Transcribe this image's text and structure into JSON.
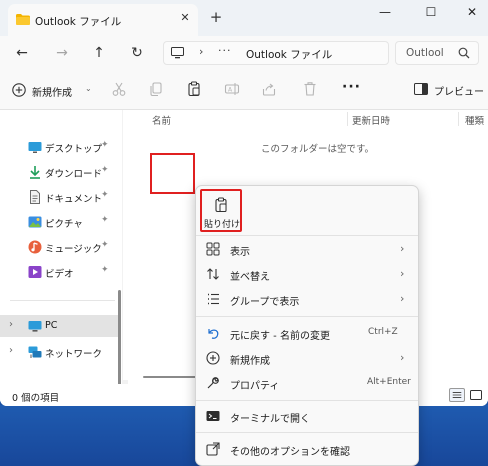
{
  "window": {
    "tab_title": "Outlook ファイル",
    "new_tab": "+",
    "controls": {
      "minimize": "—",
      "maximize": "☐",
      "close": "✕"
    }
  },
  "address": {
    "back": "←",
    "forward": "→",
    "up": "↑",
    "refresh": "↻",
    "chevron": "›",
    "ellipsis": "···",
    "path": "Outlook ファイル",
    "search_placeholder": "Outlook ファイルの検索",
    "search_visible": "Outlool"
  },
  "toolbar": {
    "new_label": "新規作成",
    "new_chevron": "⌄",
    "more": "···",
    "preview_label": "プレビュー"
  },
  "sidebar": {
    "pin": "📌",
    "items": [
      {
        "label": "デスクトップ",
        "icon": "desktop-icon"
      },
      {
        "label": "ダウンロード",
        "icon": "download-icon"
      },
      {
        "label": "ドキュメント",
        "icon": "document-icon"
      },
      {
        "label": "ピクチャ",
        "icon": "pictures-icon"
      },
      {
        "label": "ミュージック",
        "icon": "music-icon"
      },
      {
        "label": "ビデオ",
        "icon": "video-icon"
      }
    ],
    "pc_label": "PC",
    "network_label": "ネットワーク",
    "chevron": "›"
  },
  "content": {
    "columns": [
      "名前",
      "更新日時",
      "種類"
    ],
    "empty_message": "このフォルダーは空です。"
  },
  "status": {
    "item_count": "0 個の項目"
  },
  "context_menu": {
    "paste_label": "貼り付け",
    "items": [
      {
        "label": "表示",
        "icon": "view-icon",
        "submenu": true
      },
      {
        "label": "並べ替え",
        "icon": "sort-icon",
        "submenu": true
      },
      {
        "label": "グループで表示",
        "icon": "group-icon",
        "submenu": true
      },
      {
        "label": "元に戻す - 名前の変更",
        "icon": "undo-icon",
        "shortcut": "Ctrl+Z"
      },
      {
        "label": "新規作成",
        "icon": "new-icon",
        "submenu": true
      },
      {
        "label": "プロパティ",
        "icon": "properties-icon",
        "shortcut": "Alt+Enter"
      },
      {
        "label": "ターミナルで開く",
        "icon": "terminal-icon"
      },
      {
        "label": "その他のオプションを確認",
        "icon": "more-options-icon"
      }
    ],
    "chevron": "›"
  },
  "colors": {
    "highlight_red": "#e02020",
    "desktop_blue": "#1b52a3",
    "accent_blue": "#0067c0"
  }
}
